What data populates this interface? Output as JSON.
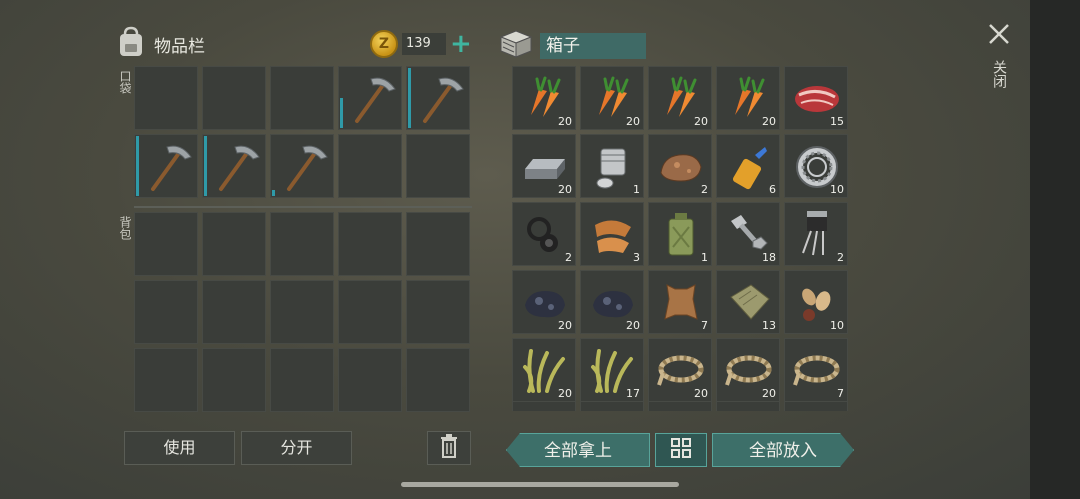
{
  "inventory": {
    "title": "物品栏",
    "coins": "139",
    "pocket_label": "口袋",
    "backpack_label": "背包",
    "pocket_slots": [
      {
        "item": "empty"
      },
      {
        "item": "empty"
      },
      {
        "item": "empty"
      },
      {
        "item": "pickaxe",
        "durability": 0.5
      },
      {
        "item": "pickaxe",
        "durability": 1.0
      },
      {
        "item": "pickaxe",
        "durability": 1.0
      },
      {
        "item": "pickaxe",
        "durability": 1.0
      },
      {
        "item": "pickaxe",
        "durability": 0.1
      },
      {
        "item": "empty"
      },
      {
        "item": "empty"
      }
    ],
    "backpack_slots": 15
  },
  "box": {
    "title": "箱子",
    "items": [
      {
        "item": "carrot-icon",
        "qty": "20"
      },
      {
        "item": "carrot-icon",
        "qty": "20"
      },
      {
        "item": "carrot-icon",
        "qty": "20"
      },
      {
        "item": "carrot-icon",
        "qty": "20"
      },
      {
        "item": "raw-meat-icon",
        "qty": "15"
      },
      {
        "item": "metal-ingot-icon",
        "qty": "20"
      },
      {
        "item": "engine-cylinder-icon",
        "qty": "1"
      },
      {
        "item": "ore-rock-icon",
        "qty": "2"
      },
      {
        "item": "glue-tube-icon",
        "qty": "6"
      },
      {
        "item": "bearing-icon",
        "qty": "10"
      },
      {
        "item": "rubber-seal-icon",
        "qty": "2"
      },
      {
        "item": "leather-scraps-icon",
        "qty": "3"
      },
      {
        "item": "jerrycan-icon",
        "qty": "1"
      },
      {
        "item": "bolt-nut-icon",
        "qty": "18"
      },
      {
        "item": "transistor-icon",
        "qty": "2"
      },
      {
        "item": "coal-icon",
        "qty": "20"
      },
      {
        "item": "coal-icon",
        "qty": "20"
      },
      {
        "item": "animal-hide-icon",
        "qty": "7"
      },
      {
        "item": "cloth-icon",
        "qty": "13"
      },
      {
        "item": "seeds-icon",
        "qty": "10"
      },
      {
        "item": "plant-fiber-icon",
        "qty": "20"
      },
      {
        "item": "plant-fiber-icon",
        "qty": "17"
      },
      {
        "item": "rope-icon",
        "qty": "20"
      },
      {
        "item": "rope-icon",
        "qty": "20"
      },
      {
        "item": "rope-icon",
        "qty": "7"
      }
    ]
  },
  "buttons": {
    "use": "使用",
    "split": "分开",
    "take_all": "全部拿上",
    "put_all": "全部放入",
    "close": "关闭"
  },
  "colors": {
    "accent": "#3d6f69",
    "durability": "#2f9aa8",
    "coin": "#e3b62c"
  }
}
